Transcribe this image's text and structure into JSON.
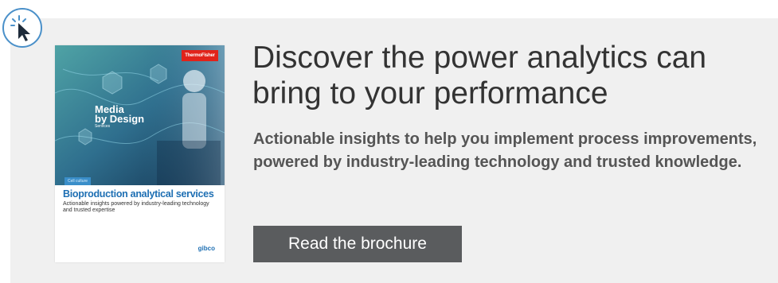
{
  "promo": {
    "headline": "Discover the power analytics can bring to your performance",
    "subcopy": "Actionable insights to help you implement process improvements, powered by industry-leading technology and trusted knowledge.",
    "cta_label": "Read the brochure"
  },
  "brochure_cover": {
    "brand_tag": "ThermoFisher",
    "hero_line1": "Media",
    "hero_line2": "by Design",
    "hero_sub": "Services",
    "category_chip": "Cell culture",
    "title": "Bioproduction analytical services",
    "subtitle": "Actionable insights powered by industry-leading technology and trusted expertise",
    "logo": "gibco"
  },
  "icons": {
    "cursor_badge": "pointer-click-icon"
  },
  "colors": {
    "banner_bg": "#f0f0f0",
    "cta_bg": "#5a5c5e",
    "accent_blue": "#4a90c9",
    "brand_red": "#e1231a"
  }
}
